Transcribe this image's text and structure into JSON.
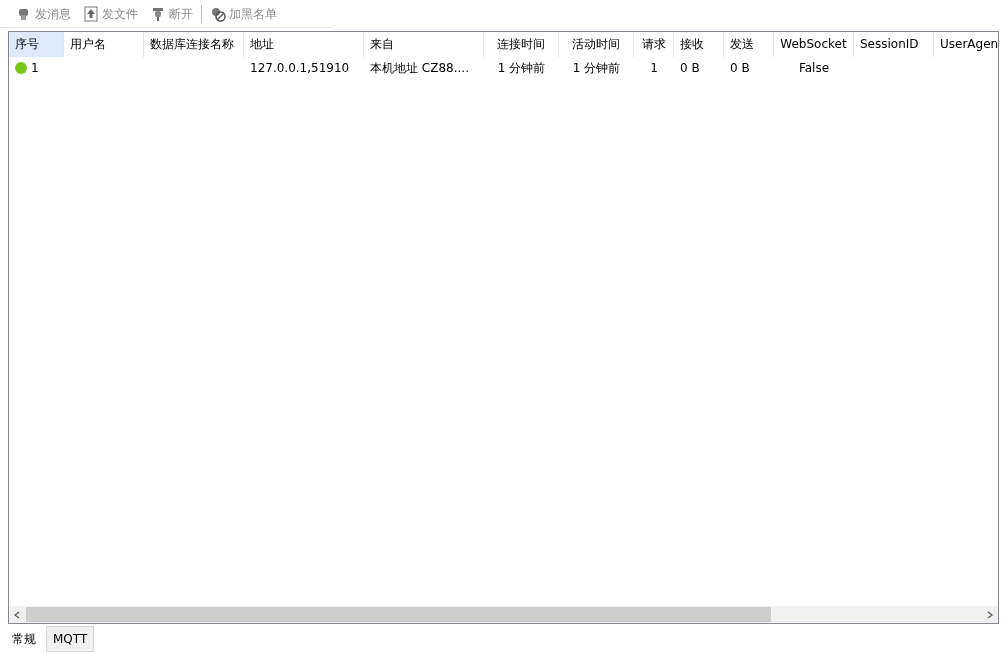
{
  "toolbar": [
    {
      "label": "发消息",
      "disabled": true
    },
    {
      "label": "发文件",
      "disabled": true
    },
    {
      "label": "断开",
      "disabled": true
    },
    {
      "label": "加黑名单",
      "disabled": true
    }
  ],
  "table": {
    "columns": [
      {
        "label": "序号",
        "sorted": true
      },
      {
        "label": "用户名",
        "sorted": false
      },
      {
        "label": "数据库连接名称",
        "sorted": false
      },
      {
        "label": "地址",
        "sorted": false
      },
      {
        "label": "来自",
        "sorted": false
      },
      {
        "label": "连接时间",
        "sorted": false
      },
      {
        "label": "活动时间",
        "sorted": false
      },
      {
        "label": "请求",
        "sorted": false
      },
      {
        "label": "接收",
        "sorted": false
      },
      {
        "label": "发送",
        "sorted": false
      },
      {
        "label": "WebSocket",
        "sorted": false
      },
      {
        "label": "SessionID",
        "sorted": false
      },
      {
        "label": "UserAgen",
        "sorted": false
      }
    ],
    "rows": [
      {
        "color": "#7cc61c",
        "cells": [
          "1",
          "",
          "",
          "127.0.0.1,51910",
          "本机地址  CZ88....",
          "1 分钟前",
          "1 分钟前",
          "1",
          "0 B",
          "0 B",
          "False",
          "",
          ""
        ]
      }
    ]
  },
  "tabs": [
    {
      "label": "常规",
      "selected": true
    },
    {
      "label": "MQTT",
      "selected": false
    }
  ]
}
